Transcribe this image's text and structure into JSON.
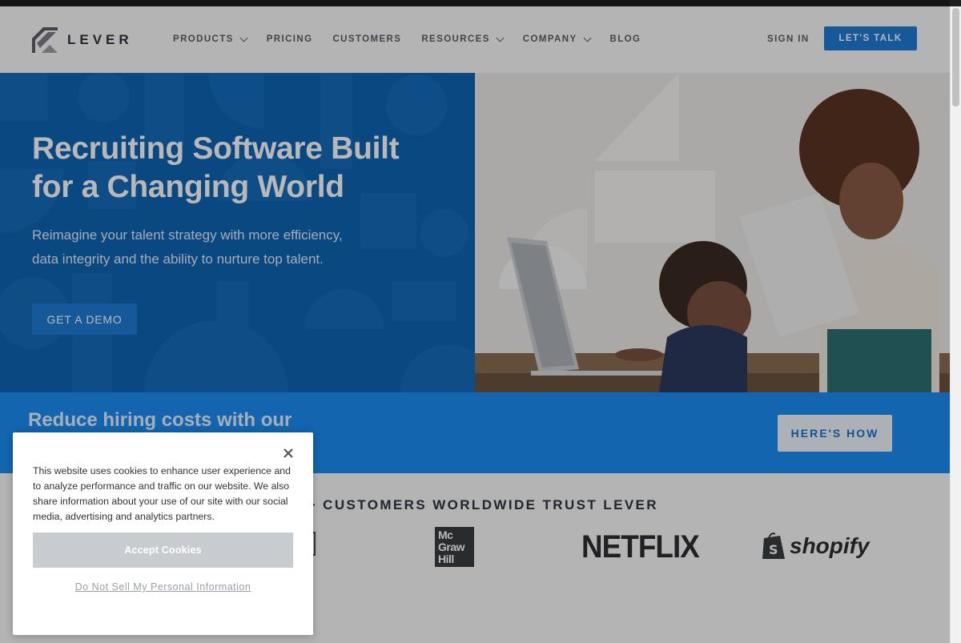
{
  "nav": {
    "logo_text": "LEVER",
    "links": [
      {
        "label": "PRODUCTS",
        "dropdown": true
      },
      {
        "label": "PRICING",
        "dropdown": false
      },
      {
        "label": "CUSTOMERS",
        "dropdown": false
      },
      {
        "label": "RESOURCES",
        "dropdown": true
      },
      {
        "label": "COMPANY",
        "dropdown": true
      },
      {
        "label": "BLOG",
        "dropdown": false
      }
    ],
    "sign_in": "SIGN IN",
    "cta": "LET'S TALK"
  },
  "hero": {
    "title": "Recruiting Software Built for a Changing World",
    "subtitle": "Reimagine your talent strategy with more efficiency, data integrity and the ability to nurture top talent.",
    "cta": "GET A DEMO"
  },
  "banner": {
    "title": "Reduce hiring costs with our",
    "cta": "HERE'S HOW"
  },
  "customers": {
    "title": "00+ CUSTOMERS WORLDWIDE TRUST LEVER",
    "logos": {
      "mcgrawhill_lines": [
        "Mc",
        "Graw",
        "Hill"
      ],
      "netflix": "NETFLIX",
      "shopify": "shopify"
    }
  },
  "cookie": {
    "text": "This website uses cookies to enhance user experience and to analyze performance and traffic on our website. We also share information about your use of our site with our social media, advertising and analytics partners.",
    "accept": "Accept Cookies",
    "do_not_sell": "Do Not Sell My Personal Information"
  },
  "colors": {
    "brand_blue": "#1f7cd6",
    "hero_blue": "#0f64b4",
    "banner_blue": "#1a8cf2"
  }
}
